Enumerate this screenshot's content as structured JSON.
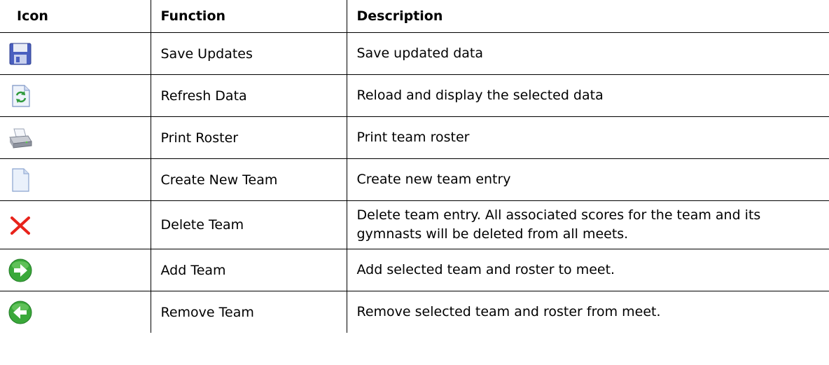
{
  "headers": {
    "icon": "Icon",
    "function": "Function",
    "description": "Description"
  },
  "rows": [
    {
      "icon": "save-floppy-icon",
      "function": "Save Updates",
      "description": "Save updated data"
    },
    {
      "icon": "refresh-document-icon",
      "function": "Refresh Data",
      "description": "Reload and display the selected data"
    },
    {
      "icon": "printer-icon",
      "function": "Print Roster",
      "description": "Print team roster"
    },
    {
      "icon": "new-document-icon",
      "function": "Create New Team",
      "description": "Create new team entry"
    },
    {
      "icon": "delete-x-icon",
      "function": "Delete Team",
      "description": "Delete team entry.  All associated scores for the team and its gymnasts will be deleted from all meets."
    },
    {
      "icon": "green-arrow-right-icon",
      "function": "Add Team",
      "description": "Add selected team and roster to meet."
    },
    {
      "icon": "green-arrow-left-icon",
      "function": "Remove Team",
      "description": "Remove selected team and roster from meet."
    }
  ],
  "colors": {
    "delete_red": "#e8231b",
    "arrow_green": "#3aa83a",
    "floppy_blue": "#4a5fbf"
  }
}
